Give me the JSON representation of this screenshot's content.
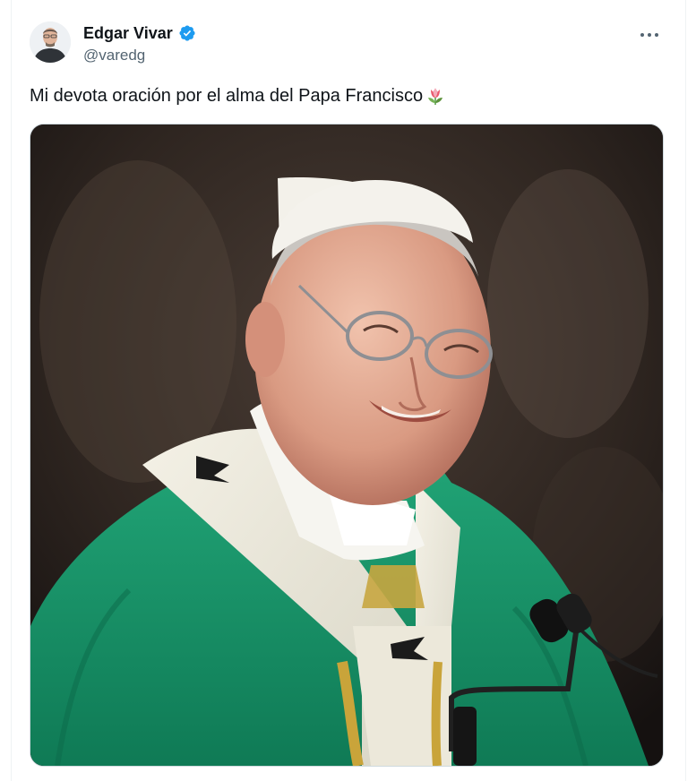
{
  "tweet": {
    "author": {
      "display_name": "Edgar Vivar",
      "handle": "@varedg",
      "verified": true,
      "avatar_icon": "user-avatar"
    },
    "text": "Mi devota oración por el alma del Papa Francisco",
    "emoji": "tulip-icon",
    "more_icon": "more-icon",
    "colors": {
      "verified_badge": "#1d9bf0",
      "text_primary": "#0f1419",
      "text_secondary": "#536471"
    }
  }
}
